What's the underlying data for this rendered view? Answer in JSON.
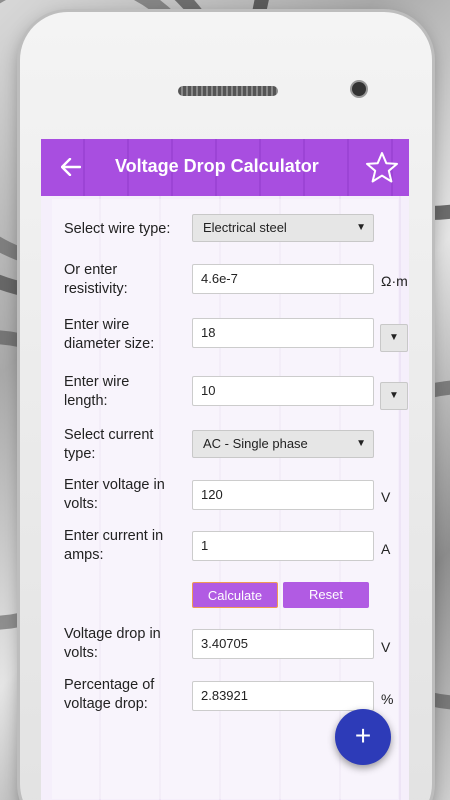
{
  "appbar": {
    "title": "Voltage Drop Calculator",
    "back_icon": "arrow-left-icon",
    "favorite_icon": "star-icon"
  },
  "form": {
    "wire_type": {
      "label": "Select wire type:",
      "value": "Electrical steel"
    },
    "resistivity": {
      "label_line1": "Or enter",
      "label_line2": "resistivity:",
      "value": "4.6e-7",
      "unit": "Ω·m"
    },
    "diameter": {
      "label_line1": "Enter wire",
      "label_line2": "diameter size:",
      "value": "18"
    },
    "length": {
      "label_line1": "Enter wire",
      "label_line2": "length:",
      "value": "10"
    },
    "current_type": {
      "label_line1": "Select current",
      "label_line2": "type:",
      "value": "AC - Single phase"
    },
    "voltage": {
      "label_line1": "Enter voltage in",
      "label_line2": "volts:",
      "value": "120",
      "unit": "V"
    },
    "current": {
      "label_line1": "Enter current in",
      "label_line2": "amps:",
      "value": "1",
      "unit": "A"
    },
    "calculate_label": "Calculate",
    "reset_label": "Reset",
    "voltage_drop": {
      "label_line1": "Voltage drop in",
      "label_line2": "volts:",
      "value": "3.40705",
      "unit": "V"
    },
    "percentage_drop": {
      "label_line1": "Percentage of",
      "label_line2": "voltage drop:",
      "value": "2.83921",
      "unit": "%"
    }
  },
  "fab": {
    "icon": "plus-icon",
    "label": "+"
  },
  "colors": {
    "appbar": "#a84ee0",
    "button": "#b15be3",
    "fab": "#2d3bb8"
  }
}
